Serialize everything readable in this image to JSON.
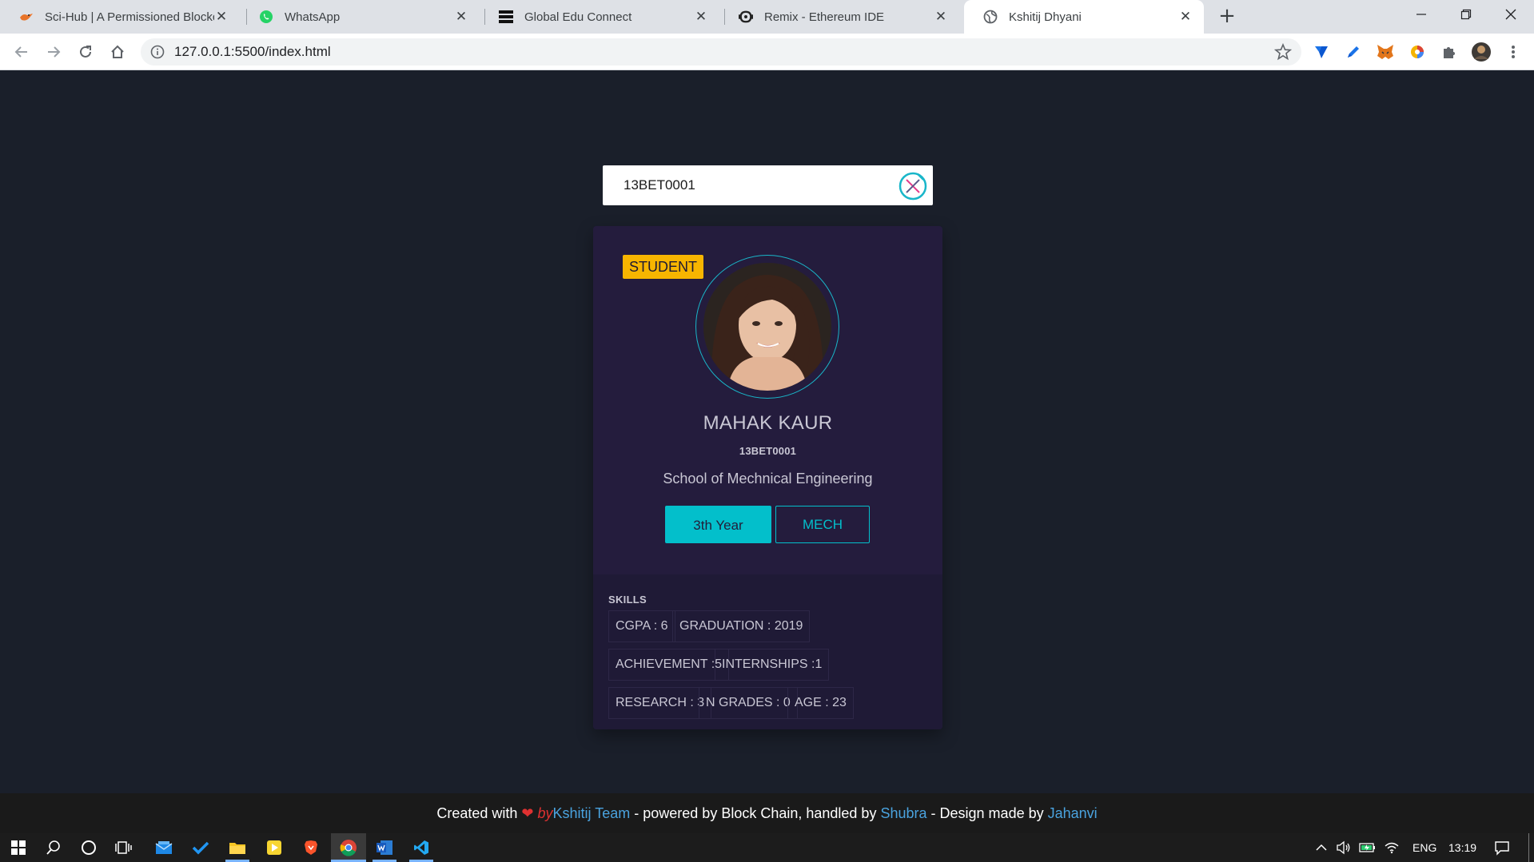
{
  "browser": {
    "tabs": [
      {
        "title": "Sci-Hub | A Permissioned Blockch",
        "icon": "scihub-raven-icon"
      },
      {
        "title": "WhatsApp",
        "icon": "whatsapp-icon"
      },
      {
        "title": "Global Edu Connect",
        "icon": "menu-lines-icon"
      },
      {
        "title": "Remix - Ethereum IDE",
        "icon": "remix-icon"
      },
      {
        "title": "Kshitij Dhyani",
        "icon": "globe-icon",
        "active": true
      }
    ],
    "url": "127.0.0.1:5500/index.html"
  },
  "search": {
    "value": "13BET0001"
  },
  "profile": {
    "role_badge": "STUDENT",
    "name": "MAHAK KAUR",
    "roll_no": "13BET0001",
    "school": "School of Mechnical Engineering",
    "year_label": "3th Year",
    "dept_label": "MECH"
  },
  "skills": {
    "title": "SKILLS",
    "items": [
      "CGPA : 6",
      "GRADUATION : 2019",
      "ACHIEVEMENT :5",
      "INTERNSHIPS :1",
      "RESEARCH : 3",
      "N GRADES : 0",
      "AGE : 23"
    ]
  },
  "footer": {
    "created_with": "Created with",
    "by": "by",
    "team": "Kshitij Team",
    "powered": "- powered by Block Chain, handled by",
    "handler": "Shubra",
    "design": "- Design made by",
    "designer": "Jahanvi"
  },
  "taskbar": {
    "language": "ENG",
    "time": "13:19"
  },
  "colors": {
    "page_bg": "#1a1f2a",
    "card_bg": "#241c3d",
    "accent": "#03bfcb",
    "badge": "#f7b500"
  }
}
